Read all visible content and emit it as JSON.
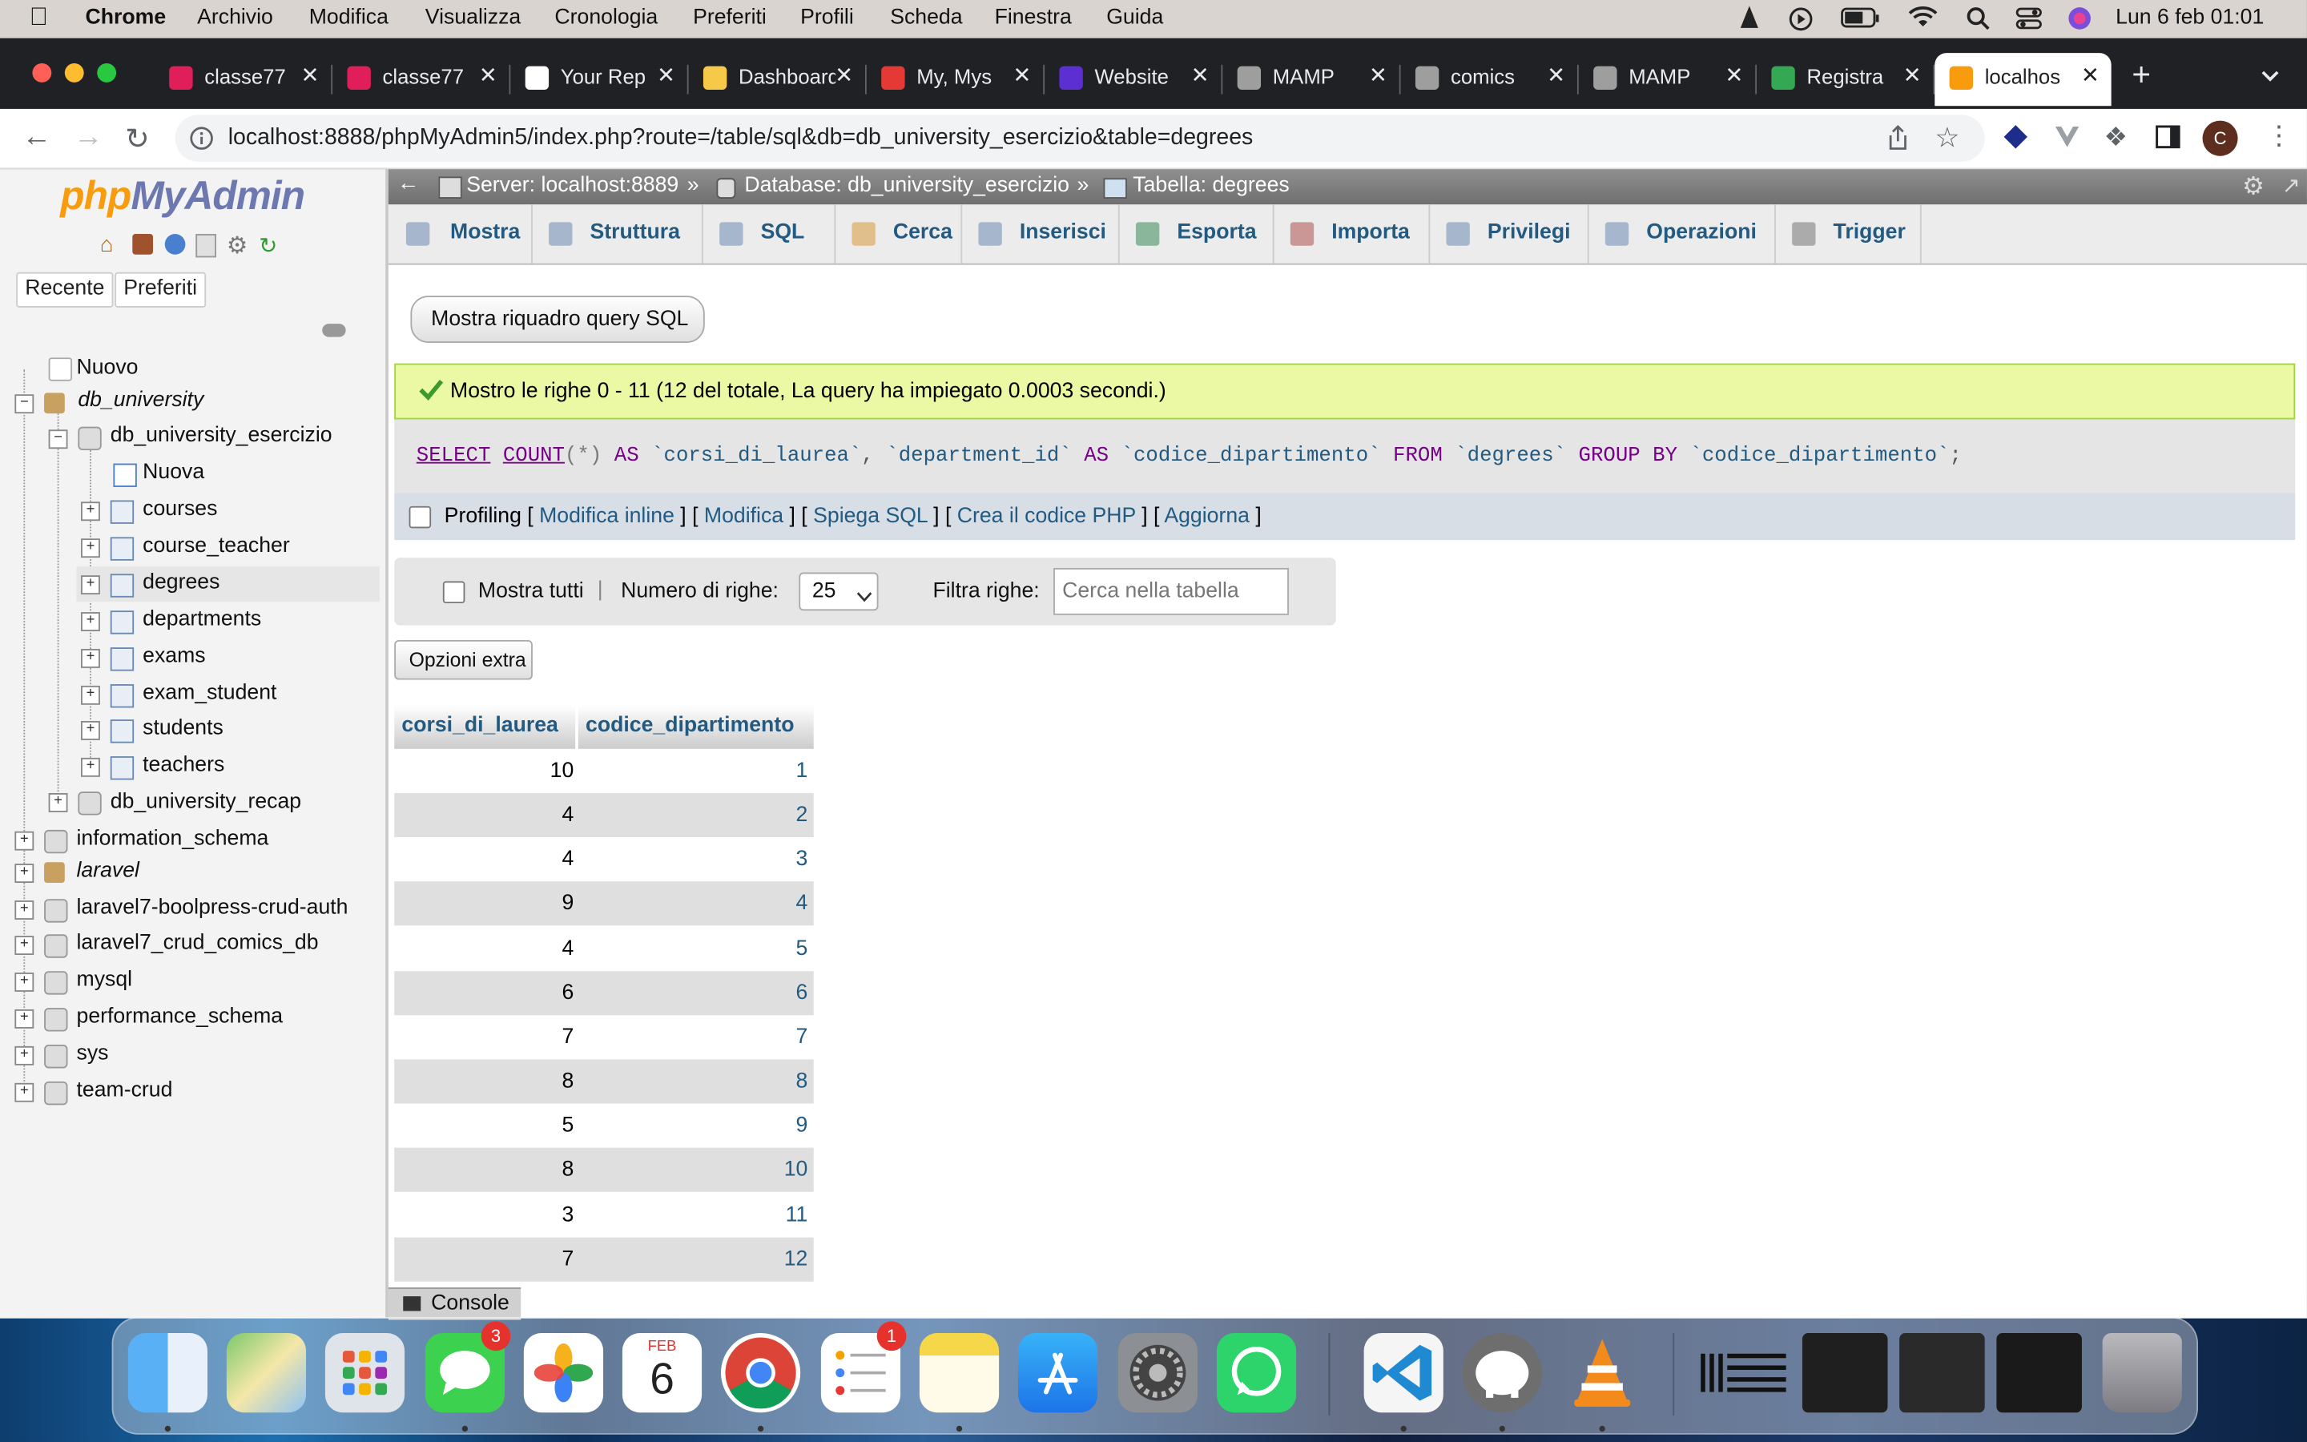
{
  "menubar": {
    "app": "Chrome",
    "items": [
      "Archivio",
      "Modifica",
      "Visualizza",
      "Cronologia",
      "Preferiti",
      "Profili",
      "Scheda",
      "Finestra",
      "Guida"
    ],
    "clock": "Lun 6 feb  01:01"
  },
  "tabs": [
    {
      "title": "classe77",
      "favicon_color": "#e01e5a"
    },
    {
      "title": "classe77",
      "favicon_color": "#e01e5a"
    },
    {
      "title": "Your Rep",
      "favicon_color": "#ffffff"
    },
    {
      "title": "Dashboard",
      "favicon_color": "#f7c948"
    },
    {
      "title": "My, Mys",
      "favicon_color": "#e53935"
    },
    {
      "title": "Website",
      "favicon_color": "#5b2fd1"
    },
    {
      "title": "MAMP",
      "favicon_color": "#9e9e9e"
    },
    {
      "title": "comics",
      "favicon_color": "#9e9e9e"
    },
    {
      "title": "MAMP",
      "favicon_color": "#9e9e9e"
    },
    {
      "title": "Registra",
      "favicon_color": "#34a853"
    },
    {
      "title": "localhos",
      "favicon_color": "#f89c0e",
      "active": true
    }
  ],
  "omnibox": {
    "url": "localhost:8888/phpMyAdmin5/index.php?route=/table/sql&db=db_university_esercizio&table=degrees"
  },
  "profile_initial": "C",
  "sidebar": {
    "logo_php": "php",
    "logo_rest": "MyAdmin",
    "buttons": [
      "Recente",
      "Preferiti"
    ],
    "tree": [
      {
        "label": "Nuovo",
        "italic": false
      },
      {
        "label": "db_university",
        "italic": true
      },
      {
        "label": "db_university_esercizio",
        "italic": false
      },
      {
        "label": "Nuova",
        "italic": false
      },
      {
        "label": "courses",
        "italic": false
      },
      {
        "label": "course_teacher",
        "italic": false
      },
      {
        "label": "degrees",
        "italic": false
      },
      {
        "label": "departments",
        "italic": false
      },
      {
        "label": "exams",
        "italic": false
      },
      {
        "label": "exam_student",
        "italic": false
      },
      {
        "label": "students",
        "italic": false
      },
      {
        "label": "teachers",
        "italic": false
      },
      {
        "label": "db_university_recap",
        "italic": false
      },
      {
        "label": "information_schema",
        "italic": false
      },
      {
        "label": "laravel",
        "italic": true
      },
      {
        "label": "laravel7-boolpress-crud-auth",
        "italic": false
      },
      {
        "label": "laravel7_crud_comics_db",
        "italic": false
      },
      {
        "label": "mysql",
        "italic": false
      },
      {
        "label": "performance_schema",
        "italic": false
      },
      {
        "label": "sys",
        "italic": false
      },
      {
        "label": "team-crud",
        "italic": false
      }
    ]
  },
  "breadcrumb": {
    "server": "Server: localhost:8889",
    "database": "Database: db_university_esercizio",
    "table": "Tabella: degrees",
    "separator": "»"
  },
  "pma_tabs": [
    "Mostra",
    "Struttura",
    "SQL",
    "Cerca",
    "Inserisci",
    "Esporta",
    "Importa",
    "Privilegi",
    "Operazioni",
    "Trigger"
  ],
  "show_query_button": "Mostra riquadro query SQL",
  "success_message": "Mostro le righe 0 - 11 (12 del totale, La query ha impiegato 0.0003 secondi.)",
  "sql": {
    "select": "SELECT",
    "count": "COUNT",
    "star": "(*)",
    "as": "AS",
    "alias1": "`corsi_di_laurea`",
    "comma": ",",
    "col": "`department_id`",
    "alias2": "`codice_dipartimento`",
    "from": "FROM",
    "table": "`degrees`",
    "groupby": "GROUP BY",
    "groupcol": "`codice_dipartimento`",
    "semi": ";"
  },
  "profiling": {
    "label": "Profiling",
    "links": [
      "Modifica inline",
      "Modifica",
      "Spiega SQL",
      "Crea il codice PHP",
      "Aggiorna"
    ]
  },
  "nav": {
    "show_all": "Mostra tutti",
    "divider": "|",
    "rows_label": "Numero di righe:",
    "rows_value": "25",
    "filter_label": "Filtra righe:",
    "filter_placeholder": "Cerca nella tabella"
  },
  "extra_options": "Opzioni extra",
  "table": {
    "columns": [
      "corsi_di_laurea",
      "codice_dipartimento"
    ],
    "rows": [
      [
        "10",
        "1"
      ],
      [
        "4",
        "2"
      ],
      [
        "4",
        "3"
      ],
      [
        "9",
        "4"
      ],
      [
        "4",
        "5"
      ],
      [
        "6",
        "6"
      ],
      [
        "7",
        "7"
      ],
      [
        "8",
        "8"
      ],
      [
        "5",
        "9"
      ],
      [
        "8",
        "10"
      ],
      [
        "3",
        "11"
      ],
      [
        "7",
        "12"
      ]
    ]
  },
  "console_label": "Console",
  "dock": {
    "calendar_month": "FEB",
    "calendar_day": "6",
    "messages_badge": "3",
    "reminders_badge": "1"
  }
}
